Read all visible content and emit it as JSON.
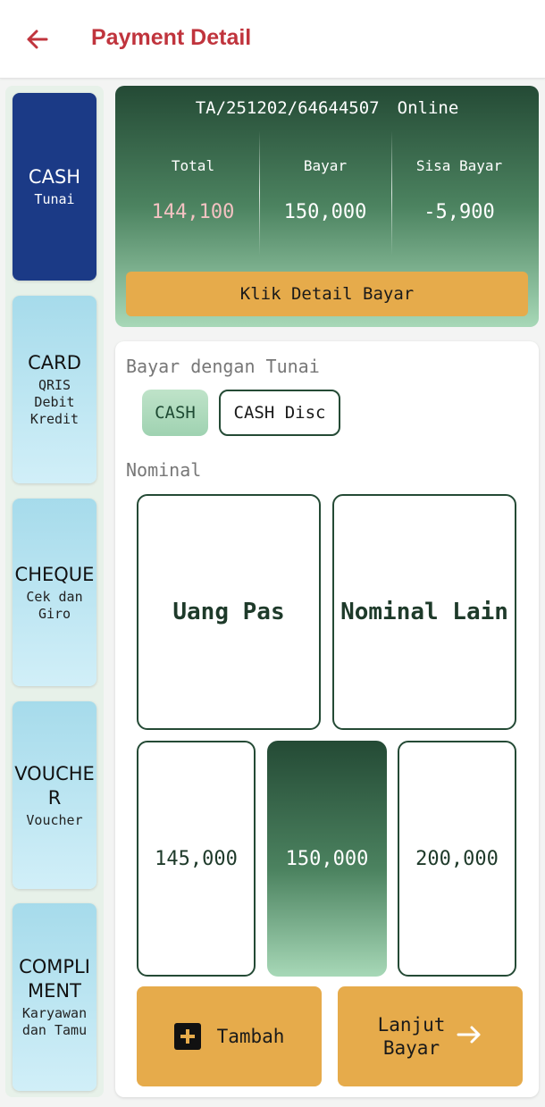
{
  "header": {
    "title": "Payment Detail"
  },
  "sidebar": {
    "items": [
      {
        "label": "CASH",
        "sub": "Tunai"
      },
      {
        "label": "CARD",
        "sub": "QRIS\nDebit\nKredit"
      },
      {
        "label": "CHEQUE",
        "sub": "Cek dan\nGiro"
      },
      {
        "label": "VOUCHE\nR",
        "sub": "Voucher"
      },
      {
        "label": "COMPLI\nMENT",
        "sub": "Karyawan\ndan Tamu"
      }
    ]
  },
  "summary": {
    "invoice": "TA/251202/64644507",
    "status": "Online",
    "total_label": "Total",
    "total_value": "144,100",
    "bayar_label": "Bayar",
    "bayar_value": "150,000",
    "sisa_label": "Sisa Bayar",
    "sisa_value": "-5,900",
    "detail_button": "Klik Detail Bayar"
  },
  "payment": {
    "section_label": "Bayar dengan Tunai",
    "chips": [
      "CASH",
      "CASH Disc"
    ],
    "nominal_label": "Nominal",
    "exact_label": "Uang Pas",
    "other_label": "Nominal Lain",
    "amounts": [
      "145,000",
      "150,000",
      "200,000"
    ],
    "selected_amount": "150,000",
    "add_button": "Tambah",
    "next_button": "Lanjut\nBayar"
  },
  "colors": {
    "accent_red": "#c0343d",
    "dark_green": "#244a35",
    "orange": "#e6ab4b",
    "active_blue": "#1b3a86",
    "side_blue": "#a6dbeb"
  }
}
